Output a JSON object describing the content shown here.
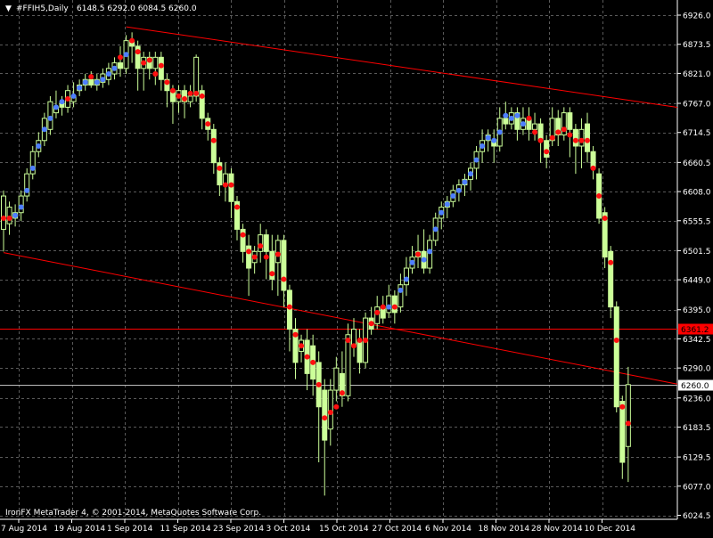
{
  "header": {
    "menu_arrow": "▼",
    "symbol_timeframe": "#FFIH5,Daily",
    "ohlc": "6148.5 6292.0 6084.5 6260.0"
  },
  "footer": {
    "copyright": "IronFX MetaTrader 4, © 2001-2014, MetaQuotes Software Corp."
  },
  "colors": {
    "background": "#000000",
    "grid": "#5a5a5a",
    "candle": "#ccff99",
    "trendline": "#ff0000",
    "dot_up": "#4e7fff",
    "dot_down": "#ff1010"
  },
  "price_labels": {
    "hline_label": "6361.2",
    "current_label": "6260.0"
  },
  "chart_data": {
    "type": "candlestick",
    "y_ticks": [
      "6926.0",
      "6873.5",
      "6821.0",
      "6767.0",
      "6714.5",
      "6660.5",
      "6608.0",
      "6555.5",
      "6501.5",
      "6449.0",
      "6395.0",
      "6342.5",
      "6290.0",
      "6236.0",
      "6183.5",
      "6129.5",
      "6077.0",
      "6024.5"
    ],
    "x_ticks": [
      "7 Aug 2014",
      "19 Aug 2014",
      "1 Sep 2014",
      "11 Sep 2014",
      "23 Sep 2014",
      "3 Oct 2014",
      "15 Oct 2014",
      "27 Oct 2014",
      "6 Nov 2014",
      "18 Nov 2014",
      "28 Nov 2014",
      "10 Dec 2014"
    ],
    "ylim": [
      6024.5,
      6926.0
    ],
    "horizontal_line": 6361.2,
    "current_price": 6260.0,
    "candles": [
      {
        "o": 6540,
        "c": 6600,
        "h": 6610,
        "l": 6500,
        "dot": "down",
        "dv": 6560
      },
      {
        "o": 6550,
        "c": 6580,
        "h": 6590,
        "l": 6530,
        "dot": "down",
        "dv": 6560
      },
      {
        "o": 6560,
        "c": 6570,
        "h": 6585,
        "l": 6545,
        "dot": "up",
        "dv": 6565
      },
      {
        "o": 6570,
        "c": 6600,
        "h": 6610,
        "l": 6555,
        "dot": "up",
        "dv": 6580
      },
      {
        "o": 6600,
        "c": 6640,
        "h": 6650,
        "l": 6590,
        "dot": "up",
        "dv": 6610
      },
      {
        "o": 6640,
        "c": 6680,
        "h": 6690,
        "l": 6630,
        "dot": "up",
        "dv": 6650
      },
      {
        "o": 6680,
        "c": 6700,
        "h": 6715,
        "l": 6670,
        "dot": "up",
        "dv": 6690
      },
      {
        "o": 6700,
        "c": 6740,
        "h": 6750,
        "l": 6690,
        "dot": "up",
        "dv": 6720
      },
      {
        "o": 6720,
        "c": 6770,
        "h": 6780,
        "l": 6710,
        "dot": "up",
        "dv": 6740
      },
      {
        "o": 6750,
        "c": 6760,
        "h": 6790,
        "l": 6740,
        "dot": "up",
        "dv": 6760
      },
      {
        "o": 6770,
        "c": 6760,
        "h": 6780,
        "l": 6745,
        "dot": "up",
        "dv": 6770
      },
      {
        "o": 6760,
        "c": 6790,
        "h": 6800,
        "l": 6750,
        "dot": "down",
        "dv": 6775
      },
      {
        "o": 6770,
        "c": 6780,
        "h": 6805,
        "l": 6760,
        "dot": "up",
        "dv": 6780
      },
      {
        "o": 6790,
        "c": 6800,
        "h": 6810,
        "l": 6780,
        "dot": "up",
        "dv": 6795
      },
      {
        "o": 6800,
        "c": 6810,
        "h": 6820,
        "l": 6790,
        "dot": "up",
        "dv": 6805
      },
      {
        "o": 6810,
        "c": 6800,
        "h": 6825,
        "l": 6795,
        "dot": "down",
        "dv": 6815
      },
      {
        "o": 6800,
        "c": 6810,
        "h": 6820,
        "l": 6790,
        "dot": "up",
        "dv": 6805
      },
      {
        "o": 6805,
        "c": 6820,
        "h": 6830,
        "l": 6795,
        "dot": "up",
        "dv": 6810
      },
      {
        "o": 6810,
        "c": 6830,
        "h": 6840,
        "l": 6800,
        "dot": "up",
        "dv": 6820
      },
      {
        "o": 6820,
        "c": 6840,
        "h": 6850,
        "l": 6810,
        "dot": "up",
        "dv": 6830
      },
      {
        "o": 6840,
        "c": 6830,
        "h": 6870,
        "l": 6815,
        "dot": "down",
        "dv": 6850
      },
      {
        "o": 6830,
        "c": 6880,
        "h": 6890,
        "l": 6820,
        "dot": "up",
        "dv": 6855
      },
      {
        "o": 6880,
        "c": 6870,
        "h": 6895,
        "l": 6840,
        "dot": "down",
        "dv": 6880
      },
      {
        "o": 6870,
        "c": 6830,
        "h": 6880,
        "l": 6790,
        "dot": "down",
        "dv": 6860
      },
      {
        "o": 6830,
        "c": 6850,
        "h": 6860,
        "l": 6790,
        "dot": "down",
        "dv": 6840
      },
      {
        "o": 6850,
        "c": 6830,
        "h": 6860,
        "l": 6810,
        "dot": "down",
        "dv": 6845
      },
      {
        "o": 6830,
        "c": 6850,
        "h": 6860,
        "l": 6800,
        "dot": "down",
        "dv": 6820
      },
      {
        "o": 6850,
        "c": 6810,
        "h": 6860,
        "l": 6790,
        "dot": "down",
        "dv": 6835
      },
      {
        "o": 6810,
        "c": 6790,
        "h": 6820,
        "l": 6760,
        "dot": "down",
        "dv": 6805
      },
      {
        "o": 6790,
        "c": 6770,
        "h": 6800,
        "l": 6730,
        "dot": "down",
        "dv": 6790
      },
      {
        "o": 6770,
        "c": 6790,
        "h": 6800,
        "l": 6750,
        "dot": "down",
        "dv": 6780
      },
      {
        "o": 6790,
        "c": 6770,
        "h": 6800,
        "l": 6740,
        "dot": "down",
        "dv": 6775
      },
      {
        "o": 6770,
        "c": 6780,
        "h": 6800,
        "l": 6760,
        "dot": "down",
        "dv": 6785
      },
      {
        "o": 6780,
        "c": 6850,
        "h": 6855,
        "l": 6770,
        "dot": "down",
        "dv": 6785
      },
      {
        "o": 6790,
        "c": 6740,
        "h": 6800,
        "l": 6720,
        "dot": "down",
        "dv": 6780
      },
      {
        "o": 6740,
        "c": 6720,
        "h": 6750,
        "l": 6700,
        "dot": "down",
        "dv": 6730
      },
      {
        "o": 6720,
        "c": 6660,
        "h": 6730,
        "l": 6640,
        "dot": "down",
        "dv": 6700
      },
      {
        "o": 6660,
        "c": 6620,
        "h": 6670,
        "l": 6600,
        "dot": "down",
        "dv": 6650
      },
      {
        "o": 6620,
        "c": 6640,
        "h": 6660,
        "l": 6590,
        "dot": "down",
        "dv": 6620
      },
      {
        "o": 6640,
        "c": 6590,
        "h": 6650,
        "l": 6560,
        "dot": "down",
        "dv": 6620
      },
      {
        "o": 6590,
        "c": 6540,
        "h": 6600,
        "l": 6520,
        "dot": "down",
        "dv": 6580
      },
      {
        "o": 6540,
        "c": 6500,
        "h": 6550,
        "l": 6480,
        "dot": "down",
        "dv": 6530
      },
      {
        "o": 6510,
        "c": 6470,
        "h": 6530,
        "l": 6420,
        "dot": "down",
        "dv": 6500
      },
      {
        "o": 6480,
        "c": 6500,
        "h": 6510,
        "l": 6460,
        "dot": "down",
        "dv": 6490
      },
      {
        "o": 6500,
        "c": 6530,
        "h": 6550,
        "l": 6480,
        "dot": "down",
        "dv": 6510
      },
      {
        "o": 6530,
        "c": 6500,
        "h": 6540,
        "l": 6450,
        "dot": "down",
        "dv": 6490
      },
      {
        "o": 6500,
        "c": 6450,
        "h": 6530,
        "l": 6430,
        "dot": "down",
        "dv": 6460
      },
      {
        "o": 6480,
        "c": 6520,
        "h": 6530,
        "l": 6420,
        "dot": "down",
        "dv": 6495
      },
      {
        "o": 6520,
        "c": 6430,
        "h": 6530,
        "l": 6400,
        "dot": "down",
        "dv": 6450
      },
      {
        "o": 6430,
        "c": 6360,
        "h": 6440,
        "l": 6320,
        "dot": "down",
        "dv": 6400
      },
      {
        "o": 6360,
        "c": 6300,
        "h": 6380,
        "l": 6270,
        "dot": "down",
        "dv": 6350
      },
      {
        "o": 6320,
        "c": 6340,
        "h": 6350,
        "l": 6300,
        "dot": "down",
        "dv": 6330
      },
      {
        "o": 6340,
        "c": 6280,
        "h": 6360,
        "l": 6250,
        "dot": "down",
        "dv": 6310
      },
      {
        "o": 6330,
        "c": 6270,
        "h": 6350,
        "l": 6240,
        "dot": "down",
        "dv": 6300
      },
      {
        "o": 6300,
        "c": 6220,
        "h": 6320,
        "l": 6120,
        "dot": "down",
        "dv": 6260
      },
      {
        "o": 6250,
        "c": 6160,
        "h": 6270,
        "l": 6060,
        "dot": "down",
        "dv": 6200
      },
      {
        "o": 6180,
        "c": 6250,
        "h": 6270,
        "l": 6150,
        "dot": "down",
        "dv": 6210
      },
      {
        "o": 6250,
        "c": 6290,
        "h": 6310,
        "l": 6230,
        "dot": "down",
        "dv": 6220
      },
      {
        "o": 6280,
        "c": 6240,
        "h": 6320,
        "l": 6220,
        "dot": "down",
        "dv": 6245
      },
      {
        "o": 6240,
        "c": 6350,
        "h": 6370,
        "l": 6230,
        "dot": "down",
        "dv": 6340
      },
      {
        "o": 6330,
        "c": 6360,
        "h": 6380,
        "l": 6310,
        "dot": "down",
        "dv": 6330
      },
      {
        "o": 6340,
        "c": 6300,
        "h": 6360,
        "l": 6280,
        "dot": "down",
        "dv": 6340
      },
      {
        "o": 6300,
        "c": 6380,
        "h": 6390,
        "l": 6290,
        "dot": "down",
        "dv": 6340
      },
      {
        "o": 6380,
        "c": 6360,
        "h": 6400,
        "l": 6350,
        "dot": "down",
        "dv": 6370
      },
      {
        "o": 6370,
        "c": 6400,
        "h": 6420,
        "l": 6360,
        "dot": "down",
        "dv": 6390
      },
      {
        "o": 6400,
        "c": 6380,
        "h": 6420,
        "l": 6370,
        "dot": "down",
        "dv": 6400
      },
      {
        "o": 6390,
        "c": 6420,
        "h": 6440,
        "l": 6380,
        "dot": "up",
        "dv": 6400
      },
      {
        "o": 6420,
        "c": 6390,
        "h": 6430,
        "l": 6370,
        "dot": "down",
        "dv": 6400
      },
      {
        "o": 6400,
        "c": 6440,
        "h": 6460,
        "l": 6390,
        "dot": "up",
        "dv": 6430
      },
      {
        "o": 6440,
        "c": 6470,
        "h": 6490,
        "l": 6420,
        "dot": "up",
        "dv": 6450
      },
      {
        "o": 6470,
        "c": 6490,
        "h": 6510,
        "l": 6460,
        "dot": "up",
        "dv": 6480
      },
      {
        "o": 6490,
        "c": 6500,
        "h": 6530,
        "l": 6470,
        "dot": "down",
        "dv": 6495
      },
      {
        "o": 6500,
        "c": 6470,
        "h": 6540,
        "l": 6460,
        "dot": "up",
        "dv": 6485
      },
      {
        "o": 6470,
        "c": 6520,
        "h": 6530,
        "l": 6460,
        "dot": "up",
        "dv": 6500
      },
      {
        "o": 6520,
        "c": 6560,
        "h": 6570,
        "l": 6510,
        "dot": "up",
        "dv": 6540
      },
      {
        "o": 6560,
        "c": 6580,
        "h": 6590,
        "l": 6540,
        "dot": "up",
        "dv": 6570
      },
      {
        "o": 6580,
        "c": 6590,
        "h": 6600,
        "l": 6560,
        "dot": "up",
        "dv": 6585
      },
      {
        "o": 6590,
        "c": 6610,
        "h": 6620,
        "l": 6580,
        "dot": "up",
        "dv": 6600
      },
      {
        "o": 6610,
        "c": 6620,
        "h": 6630,
        "l": 6590,
        "dot": "up",
        "dv": 6610
      },
      {
        "o": 6620,
        "c": 6630,
        "h": 6640,
        "l": 6600,
        "dot": "up",
        "dv": 6625
      },
      {
        "o": 6630,
        "c": 6650,
        "h": 6660,
        "l": 6610,
        "dot": "up",
        "dv": 6640
      },
      {
        "o": 6650,
        "c": 6680,
        "h": 6690,
        "l": 6630,
        "dot": "up",
        "dv": 6665
      },
      {
        "o": 6680,
        "c": 6700,
        "h": 6720,
        "l": 6660,
        "dot": "up",
        "dv": 6690
      },
      {
        "o": 6700,
        "c": 6710,
        "h": 6720,
        "l": 6680,
        "dot": "up",
        "dv": 6705
      },
      {
        "o": 6700,
        "c": 6690,
        "h": 6720,
        "l": 6660,
        "dot": "up",
        "dv": 6700
      },
      {
        "o": 6690,
        "c": 6740,
        "h": 6760,
        "l": 6680,
        "dot": "up",
        "dv": 6715
      },
      {
        "o": 6740,
        "c": 6730,
        "h": 6770,
        "l": 6720,
        "dot": "up",
        "dv": 6745
      },
      {
        "o": 6730,
        "c": 6750,
        "h": 6760,
        "l": 6720,
        "dot": "up",
        "dv": 6740
      },
      {
        "o": 6750,
        "c": 6720,
        "h": 6760,
        "l": 6700,
        "dot": "up",
        "dv": 6745
      },
      {
        "o": 6720,
        "c": 6740,
        "h": 6760,
        "l": 6710,
        "dot": "up",
        "dv": 6730
      },
      {
        "o": 6740,
        "c": 6720,
        "h": 6760,
        "l": 6700,
        "dot": "down",
        "dv": 6740
      },
      {
        "o": 6720,
        "c": 6730,
        "h": 6750,
        "l": 6700,
        "dot": "down",
        "dv": 6715
      },
      {
        "o": 6730,
        "c": 6700,
        "h": 6740,
        "l": 6660,
        "dot": "down",
        "dv": 6700
      },
      {
        "o": 6700,
        "c": 6670,
        "h": 6710,
        "l": 6650,
        "dot": "down",
        "dv": 6680
      },
      {
        "o": 6700,
        "c": 6740,
        "h": 6760,
        "l": 6690,
        "dot": "down",
        "dv": 6705
      },
      {
        "o": 6740,
        "c": 6710,
        "h": 6755,
        "l": 6690,
        "dot": "down",
        "dv": 6715
      },
      {
        "o": 6710,
        "c": 6750,
        "h": 6760,
        "l": 6700,
        "dot": "down",
        "dv": 6720
      },
      {
        "o": 6750,
        "c": 6720,
        "h": 6760,
        "l": 6670,
        "dot": "down",
        "dv": 6710
      },
      {
        "o": 6720,
        "c": 6690,
        "h": 6730,
        "l": 6640,
        "dot": "down",
        "dv": 6700
      },
      {
        "o": 6690,
        "c": 6720,
        "h": 6740,
        "l": 6650,
        "dot": "down",
        "dv": 6700
      },
      {
        "o": 6730,
        "c": 6680,
        "h": 6750,
        "l": 6660,
        "dot": "down",
        "dv": 6700
      },
      {
        "o": 6680,
        "c": 6650,
        "h": 6690,
        "l": 6630,
        "dot": "down",
        "dv": 6650
      },
      {
        "o": 6640,
        "c": 6560,
        "h": 6650,
        "l": 6550,
        "dot": "down",
        "dv": 6600
      },
      {
        "o": 6570,
        "c": 6490,
        "h": 6580,
        "l": 6470,
        "dot": "down",
        "dv": 6560
      },
      {
        "o": 6500,
        "c": 6400,
        "h": 6510,
        "l": 6380,
        "dot": "down",
        "dv": 6480
      },
      {
        "o": 6400,
        "c": 6220,
        "h": 6410,
        "l": 6210,
        "dot": "down",
        "dv": 6340
      },
      {
        "o": 6230,
        "c": 6120,
        "h": 6240,
        "l": 6090,
        "dot": "down",
        "dv": 6220
      },
      {
        "o": 6148.5,
        "c": 6260,
        "h": 6292,
        "l": 6084.5,
        "dot": "down",
        "dv": 6190
      }
    ],
    "trendlines": [
      {
        "x1": 21,
        "y1": 6905,
        "x2": 112,
        "y2": 6765
      },
      {
        "x1": 0,
        "y1": 6498,
        "x2": 112,
        "y2": 6268
      }
    ]
  }
}
